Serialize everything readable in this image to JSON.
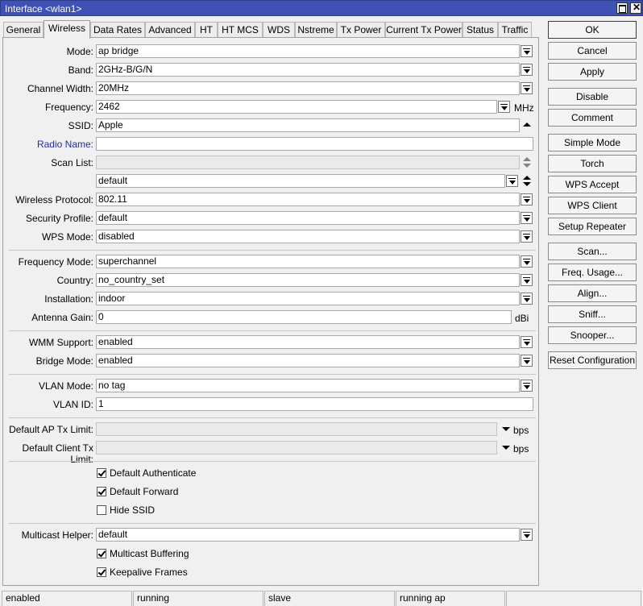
{
  "window": {
    "title": "Interface <wlan1>"
  },
  "tabs": [
    "General",
    "Wireless",
    "Data Rates",
    "Advanced",
    "HT",
    "HT MCS",
    "WDS",
    "Nstreme",
    "Tx Power",
    "Current Tx Power",
    "Status",
    "Traffic"
  ],
  "active_tab": "Wireless",
  "form": {
    "mode": {
      "label": "Mode:",
      "value": "ap bridge"
    },
    "band": {
      "label": "Band:",
      "value": "2GHz-B/G/N"
    },
    "channel_width": {
      "label": "Channel Width:",
      "value": "20MHz"
    },
    "frequency": {
      "label": "Frequency:",
      "value": "2462",
      "unit": "MHz"
    },
    "ssid": {
      "label": "SSID:",
      "value": "Apple"
    },
    "radio_name": {
      "label": "Radio Name:",
      "value": ""
    },
    "scan_list": {
      "label": "Scan List:",
      "value": "",
      "value2": "default"
    },
    "wireless_protocol": {
      "label": "Wireless Protocol:",
      "value": "802.11"
    },
    "security_profile": {
      "label": "Security Profile:",
      "value": "default"
    },
    "wps_mode": {
      "label": "WPS Mode:",
      "value": "disabled"
    },
    "frequency_mode": {
      "label": "Frequency Mode:",
      "value": "superchannel"
    },
    "country": {
      "label": "Country:",
      "value": "no_country_set"
    },
    "installation": {
      "label": "Installation:",
      "value": "indoor"
    },
    "antenna_gain": {
      "label": "Antenna Gain:",
      "value": "0",
      "unit": "dBi"
    },
    "wmm_support": {
      "label": "WMM Support:",
      "value": "enabled"
    },
    "bridge_mode": {
      "label": "Bridge Mode:",
      "value": "enabled"
    },
    "vlan_mode": {
      "label": "VLAN Mode:",
      "value": "no tag"
    },
    "vlan_id": {
      "label": "VLAN ID:",
      "value": "1"
    },
    "default_ap_tx_limit": {
      "label": "Default AP Tx Limit:",
      "value": "",
      "unit": "bps"
    },
    "default_client_tx_limit": {
      "label": "Default Client Tx Limit:",
      "value": "",
      "unit": "bps"
    },
    "default_authenticate": {
      "label": "Default Authenticate",
      "checked": true
    },
    "default_forward": {
      "label": "Default Forward",
      "checked": true
    },
    "hide_ssid": {
      "label": "Hide SSID",
      "checked": false
    },
    "multicast_helper": {
      "label": "Multicast Helper:",
      "value": "default"
    },
    "multicast_buffering": {
      "label": "Multicast Buffering",
      "checked": true
    },
    "keepalive_frames": {
      "label": "Keepalive Frames",
      "checked": true
    }
  },
  "buttons": [
    "OK",
    "Cancel",
    "Apply",
    "Disable",
    "Comment",
    "Simple Mode",
    "Torch",
    "WPS Accept",
    "WPS Client",
    "Setup Repeater",
    "Scan...",
    "Freq. Usage...",
    "Align...",
    "Sniff...",
    "Snooper...",
    "Reset Configuration"
  ],
  "status": [
    "enabled",
    "running",
    "slave",
    "running ap",
    ""
  ],
  "colors": {
    "titlebar": "#3f51b5",
    "label_link": "#1e2ea8",
    "background": "#f0f0f0"
  }
}
